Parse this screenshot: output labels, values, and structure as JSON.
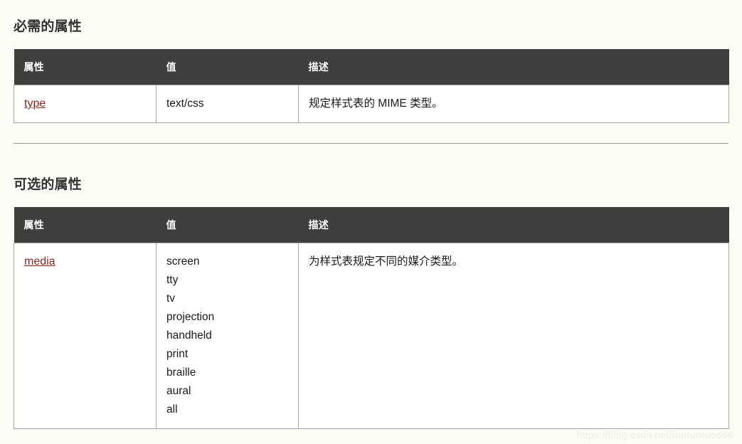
{
  "page": {
    "background_color": "#fcfcf7",
    "watermark": "https://blog.csdn.net/ruoruoruo666"
  },
  "colors": {
    "table_header_bg": "#3e3e3e",
    "table_header_text": "#ffffff",
    "link": "#8b2420",
    "border": "#a8a8a3",
    "heading": "#333333",
    "body_text": "#1a1a1a"
  },
  "sections": [
    {
      "id": "required",
      "heading": "必需的属性",
      "table": {
        "columns": [
          "属性",
          "值",
          "描述"
        ],
        "rows": [
          {
            "attribute": "type",
            "attribute_is_link": true,
            "values": [
              "text/css"
            ],
            "description": "规定样式表的 MIME 类型。"
          }
        ]
      }
    },
    {
      "id": "optional",
      "heading": "可选的属性",
      "table": {
        "columns": [
          "属性",
          "值",
          "描述"
        ],
        "rows": [
          {
            "attribute": "media",
            "attribute_is_link": true,
            "values": [
              "screen",
              "tty",
              "tv",
              "projection",
              "handheld",
              "print",
              "braille",
              "aural",
              "all"
            ],
            "description": "为样式表规定不同的媒介类型。"
          }
        ]
      }
    }
  ]
}
